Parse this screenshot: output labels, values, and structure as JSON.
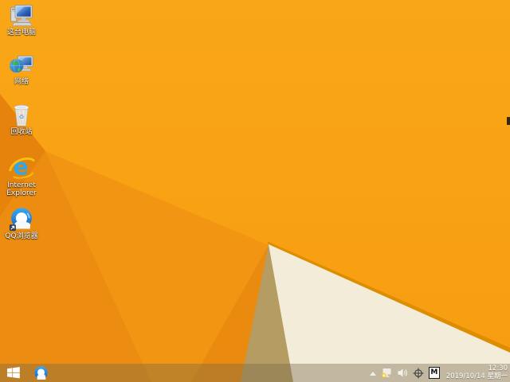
{
  "palette": {
    "wallpaper_base_top": "#F9A717",
    "wallpaper_base_bottom": "#F89C10",
    "facet_dark_wedge": "#E5830D",
    "facet_left": "#EC8D11",
    "facet_fan": "#F29512",
    "facet_fan_dark": "#EA8A0E",
    "fold_edge": "#DD8E00",
    "facet_tan": "#B59C63",
    "facet_cream": "#F3ECD9"
  },
  "desktop": {
    "icons": [
      {
        "label": "这台电脑"
      },
      {
        "label": "网络"
      },
      {
        "label": "回收站"
      },
      {
        "label": "Internet Explorer"
      },
      {
        "label": "QQ浏览器"
      }
    ]
  },
  "taskbar": {
    "tray": {
      "input_indicator": "M",
      "clock": {
        "time": "12:30",
        "date": "2019/10/14 星期一"
      }
    }
  }
}
